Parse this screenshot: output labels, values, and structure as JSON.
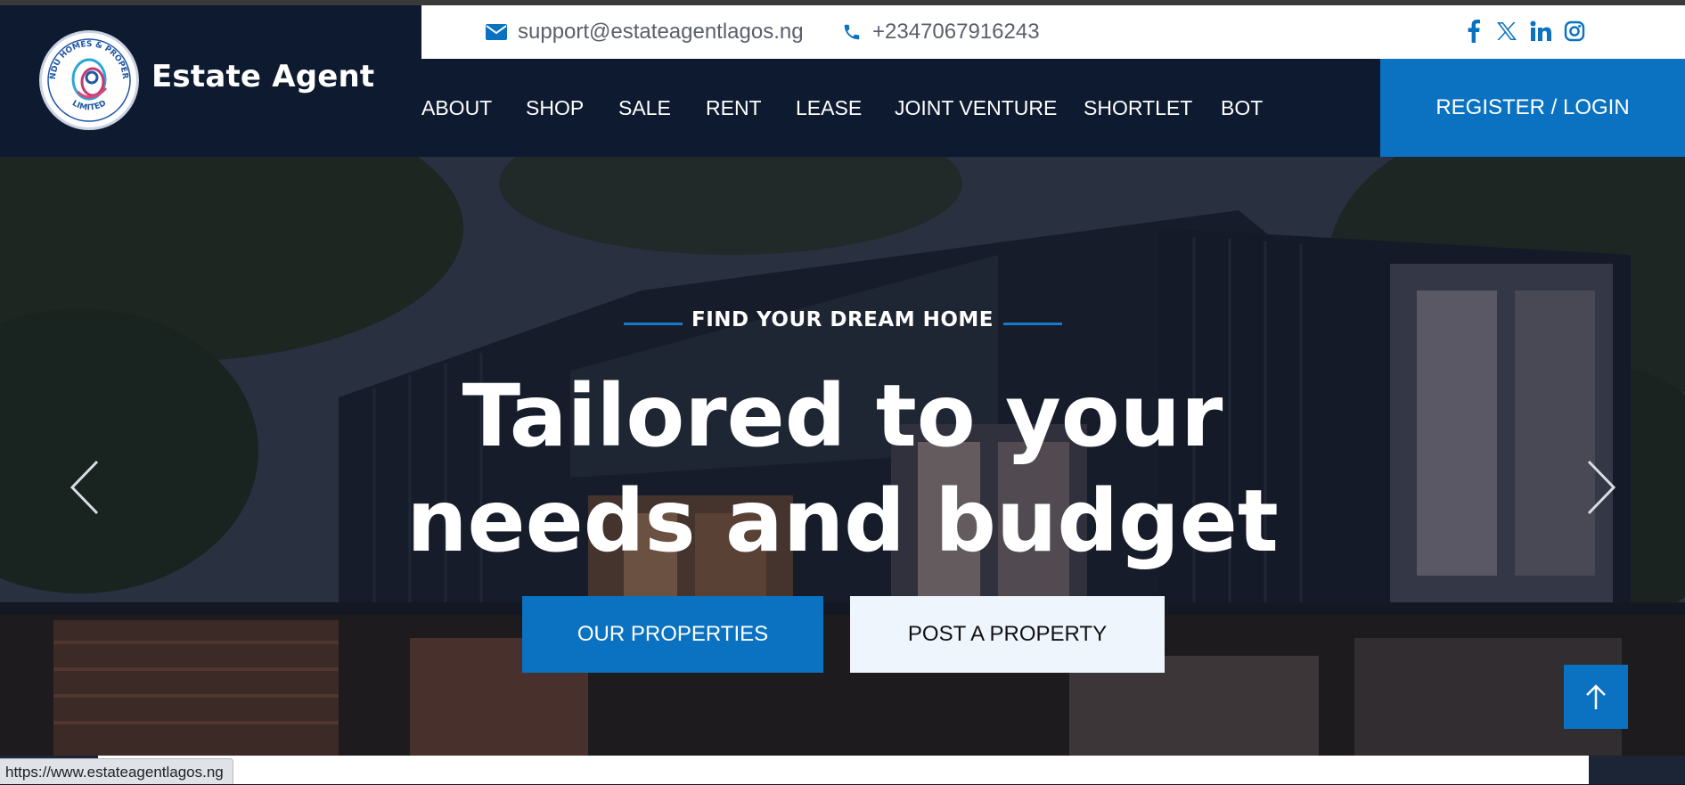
{
  "brand": {
    "name": "Estate Agent",
    "logo_ring_text": "NNENDU HOMES & PROPERTIES",
    "logo_bottom_text": "LIMITED"
  },
  "contact": {
    "email": "support@estateagentlagos.ng",
    "phone": "+2347067916243",
    "email_icon": "envelope-icon",
    "phone_icon": "phone-icon"
  },
  "social": [
    "facebook-icon",
    "x-twitter-icon",
    "linkedin-icon",
    "instagram-icon"
  ],
  "nav": {
    "items": [
      "ABOUT",
      "SHOP",
      "SALE",
      "RENT",
      "LEASE",
      "JOINT VENTURE",
      "SHORTLET",
      "BOT"
    ],
    "register": "REGISTER / LOGIN"
  },
  "hero": {
    "eyebrow": "FIND YOUR DREAM HOME",
    "headline_line1": "Tailored to your",
    "headline_line2": "needs and budget",
    "primary_button": "OUR PROPERTIES",
    "secondary_button": "POST A PROPERTY"
  },
  "status_url": "https://www.estateagentlagos.ng",
  "colors": {
    "navy": "#0e1a2f",
    "accent": "#0a72c0",
    "secondary_button_bg": "#eef5fd"
  }
}
